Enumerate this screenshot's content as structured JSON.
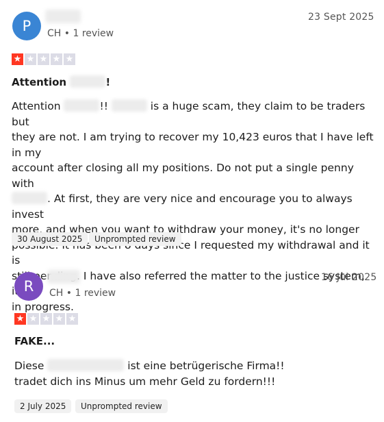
{
  "reviews": [
    {
      "avatar_letter": "P",
      "avatar_color": "#3a85d4",
      "meta": "CH • 1 review",
      "date": "23 Sept 2025",
      "rating": 1,
      "title_prefix": "Attention",
      "title_suffix": "!",
      "body": {
        "p1": "Attention",
        "p2": "!!",
        "p3": "is a huge scam, they claim to be traders but",
        "l2": "they are not. I am trying to recover my 10,423 euros that I have left in my",
        "l3": "account after closing all my positions. Do not put a single penny with",
        "l4": ". At first, they are very nice and encourage you to always invest",
        "l5": "more, and when you want to withdraw your money, it's no longer",
        "l6": "possible. It has been 8 days since I requested my withdrawal and it is",
        "l7": "still pending. I have also referred the matter to the justice system, it's",
        "l8": "in progress."
      },
      "experience_date": "30 August 2025",
      "tag": "Unprompted review"
    },
    {
      "avatar_letter": "R",
      "avatar_color": "#7a4bbf",
      "meta": "CH • 1 review",
      "date": "16 Jul 2025",
      "rating": 1,
      "title": "FAKE...",
      "body": {
        "p1": "Diese",
        "p2": "ist eine betrügerische Firma!!",
        "l2": "tradet dich ins Minus um mehr Geld zu fordern!!!"
      },
      "experience_date": "2 July 2025",
      "tag": "Unprompted review"
    }
  ],
  "icons": {
    "star": "star-icon"
  },
  "colors": {
    "star_on": "#ff3722",
    "star_off": "#dcdce6"
  }
}
